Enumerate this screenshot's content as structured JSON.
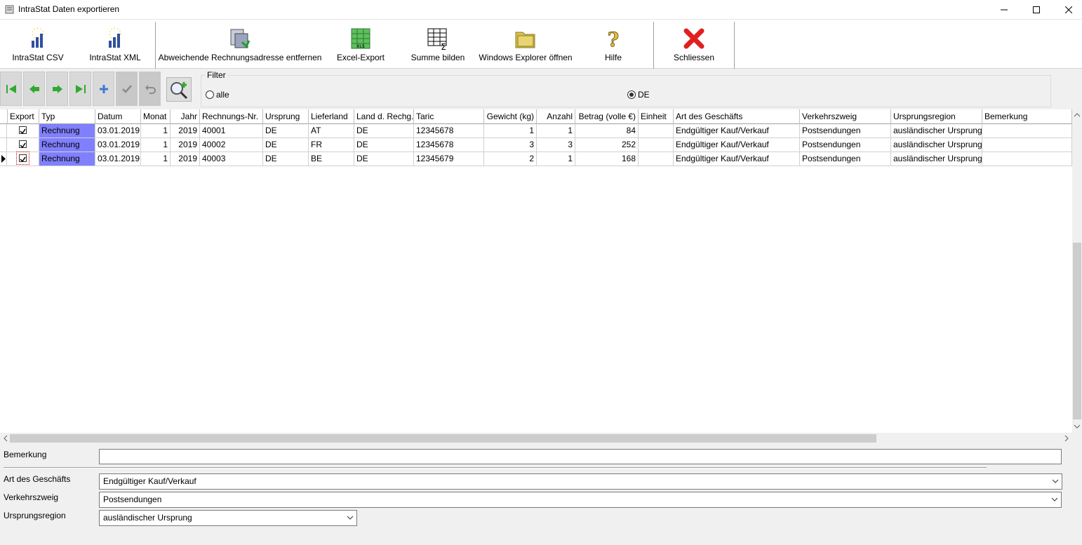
{
  "window": {
    "title": "IntraStat Daten exportieren"
  },
  "toolbar": {
    "intrastat_csv": "IntraStat CSV",
    "intrastat_xml": "IntraStat XML",
    "remove_address": "Abweichende Rechnungsadresse entfernen",
    "excel_export": "Excel-Export",
    "sum": "Summe bilden",
    "explorer": "Windows Explorer öffnen",
    "help": "Hilfe",
    "close": "Schliessen"
  },
  "filter": {
    "legend": "Filter",
    "options": [
      "alle",
      "DE"
    ],
    "selected": "DE"
  },
  "grid": {
    "columns": [
      "Export",
      "Typ",
      "Datum",
      "Monat",
      "Jahr",
      "Rechnungs-Nr.",
      "Ursprung",
      "Lieferland",
      "Land d. Rechg.",
      "Taric",
      "Gewicht (kg)",
      "Anzahl",
      "Betrag (volle €)",
      "Einheit",
      "Art des Geschäfts",
      "Verkehrszweig",
      "Ursprungsregion",
      "Bemerkung"
    ],
    "rows": [
      {
        "export": true,
        "typ": "Rechnung",
        "datum": "03.01.2019",
        "monat": "1",
        "jahr": "2019",
        "nr": "40001",
        "ursprung": "DE",
        "lieferland": "AT",
        "land": "DE",
        "taric": "12345678",
        "gewicht": "1",
        "anzahl": "1",
        "betrag": "84",
        "einheit": "",
        "art": "Endgültiger Kauf/Verkauf",
        "verkehr": "Postsendungen",
        "region": "ausländischer Ursprung",
        "bemerkung": ""
      },
      {
        "export": true,
        "typ": "Rechnung",
        "datum": "03.01.2019",
        "monat": "1",
        "jahr": "2019",
        "nr": "40002",
        "ursprung": "DE",
        "lieferland": "FR",
        "land": "DE",
        "taric": "12345678",
        "gewicht": "3",
        "anzahl": "3",
        "betrag": "252",
        "einheit": "",
        "art": "Endgültiger Kauf/Verkauf",
        "verkehr": "Postsendungen",
        "region": "ausländischer Ursprung",
        "bemerkung": ""
      },
      {
        "export": true,
        "typ": "Rechnung",
        "datum": "03.01.2019",
        "monat": "1",
        "jahr": "2019",
        "nr": "40003",
        "ursprung": "DE",
        "lieferland": "BE",
        "land": "DE",
        "taric": "12345679",
        "gewicht": "2",
        "anzahl": "1",
        "betrag": "168",
        "einheit": "",
        "art": "Endgültiger Kauf/Verkauf",
        "verkehr": "Postsendungen",
        "region": "ausländischer Ursprung",
        "bemerkung": ""
      }
    ]
  },
  "form": {
    "bemerkung_label": "Bemerkung",
    "bemerkung_value": "",
    "art_label": "Art des Geschäfts",
    "art_value": "Endgültiger Kauf/Verkauf",
    "verkehr_label": "Verkehrszweig",
    "verkehr_value": "Postsendungen",
    "region_label": "Ursprungsregion",
    "region_value": "ausländischer Ursprung"
  },
  "colors": {
    "typ_highlight": "#8080ff",
    "close_red": "#e02020",
    "nav_green": "#2faa2f"
  }
}
